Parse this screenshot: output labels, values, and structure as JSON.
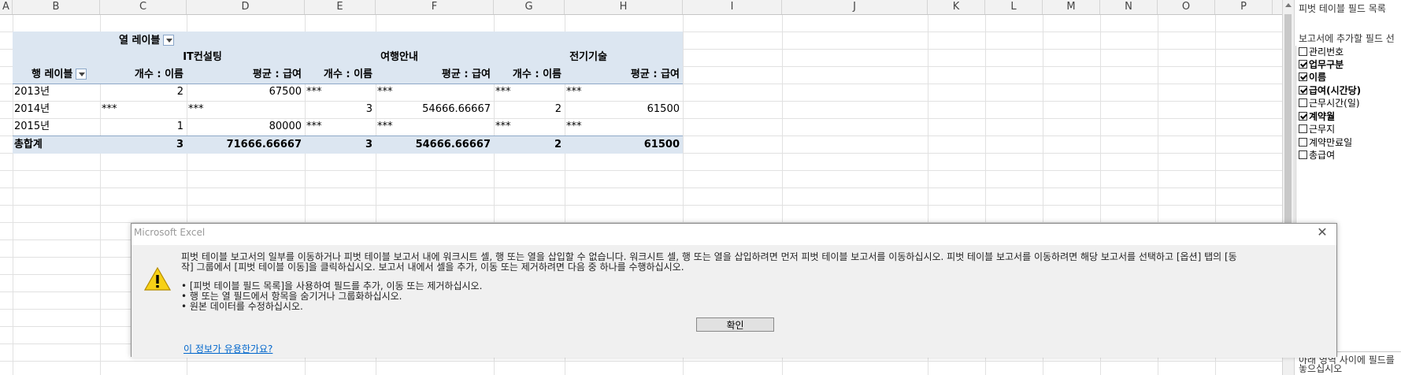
{
  "columns": [
    "A",
    "B",
    "C",
    "D",
    "E",
    "F",
    "G",
    "H",
    "I",
    "J",
    "K",
    "L",
    "M",
    "N",
    "O",
    "P"
  ],
  "pivot": {
    "col_label": "열 레이블",
    "row_label": "행 레이블",
    "groups": [
      "IT컨설팅",
      "여행안내",
      "전기기술"
    ],
    "measures": [
      "개수 : 이름",
      "평균 : 급여",
      "개수 : 이름",
      "평균 : 급여",
      "개수 : 이름",
      "평균 : 급여"
    ],
    "rows": [
      {
        "label": "2013년",
        "v": [
          "2",
          "67500",
          "***",
          "***",
          "***",
          "***"
        ]
      },
      {
        "label": "2014년",
        "v": [
          "***",
          "***",
          "3",
          "54666.66667",
          "2",
          "61500"
        ]
      },
      {
        "label": "2015년",
        "v": [
          "1",
          "80000",
          "***",
          "***",
          "***",
          "***"
        ]
      }
    ],
    "total": {
      "label": "총합계",
      "v": [
        "3",
        "71666.66667",
        "3",
        "54666.66667",
        "2",
        "61500"
      ]
    }
  },
  "dialog": {
    "title": "Microsoft Excel",
    "close": "✕",
    "message_line1": "피벗 테이블 보고서의 일부를 이동하거나 피벗 테이블 보고서 내에 워크시트 셀, 행 또는 열을 삽입할 수 없습니다. 워크시트 셀, 행 또는 열을 삽입하려면 먼저 피벗 테이블 보고서를 이동하십시오. 피벗 테이블 보고서를 이동하려면 해당 보고서를 선택하고 [옵션] 탭의 [동",
    "message_line2": "작] 그룹에서 [피벗 테이블 이동]을 클릭하십시오. 보고서 내에서 셀을 추가, 이동 또는 제거하려면 다음 중 하나를 수행하십시오.",
    "bullets": [
      "• [피벗 테이블 필드 목록]을 사용하여 필드를 추가, 이동 또는 제거하십시오.",
      "• 행 또는 열 필드에서 항목을 숨기거나 그룹화하십시오.",
      "• 원본 데이터를 수정하십시오."
    ],
    "ok": "확인",
    "link": "이 정보가 유용한가요?"
  },
  "field_pane": {
    "title": "피벗 테이블 필드 목록",
    "subtitle": "보고서에 추가할 필드 선",
    "fields": [
      {
        "label": "관리번호",
        "checked": false
      },
      {
        "label": "업무구분",
        "checked": true
      },
      {
        "label": "이름",
        "checked": true
      },
      {
        "label": "급여(시간당)",
        "checked": true
      },
      {
        "label": "근무시간(일)",
        "checked": false
      },
      {
        "label": "계약월",
        "checked": true
      },
      {
        "label": "근무지",
        "checked": false
      },
      {
        "label": "계약만료일",
        "checked": false
      },
      {
        "label": "총급여",
        "checked": false
      }
    ],
    "bottom_line1": "아래 영역 사이에 필드를",
    "bottom_line2": "놓으십시오"
  }
}
